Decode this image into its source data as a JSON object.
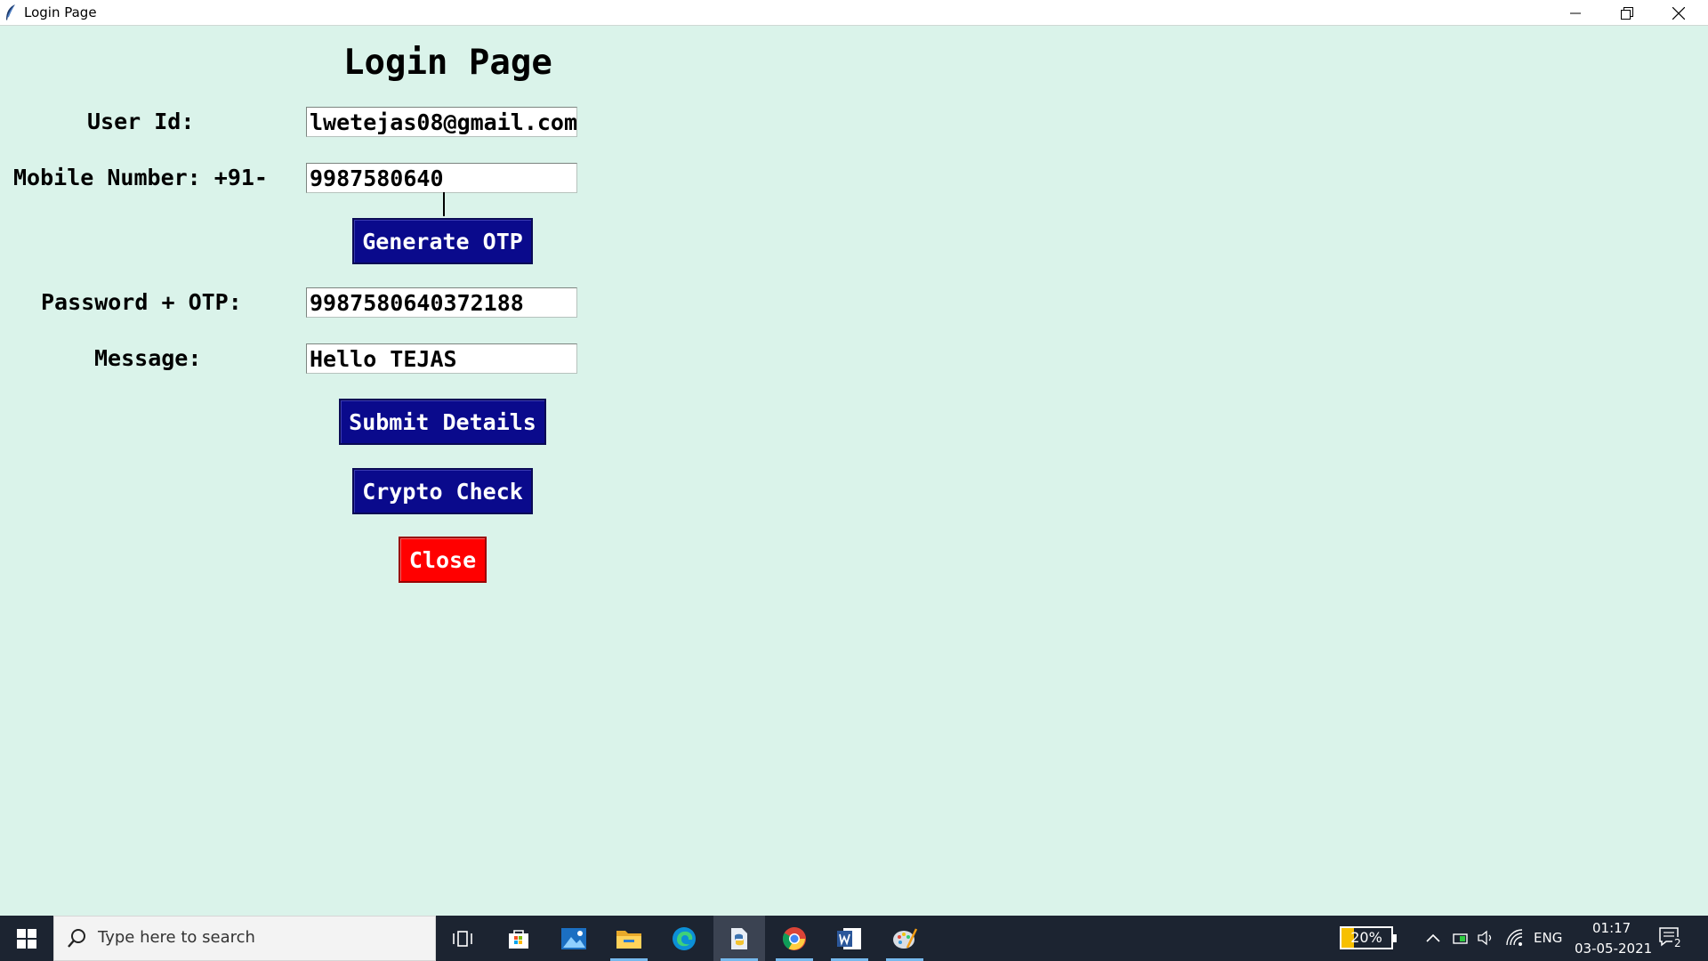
{
  "window": {
    "title": "Login Page"
  },
  "form": {
    "heading": "Login Page",
    "user_id_label": "User Id:",
    "user_id_value": "lwetejas08@gmail.com",
    "mobile_label": "Mobile Number: +91-",
    "mobile_value": "9987580640",
    "password_label": "Password + OTP:",
    "password_value": "9987580640372188",
    "message_label": "Message:",
    "message_value": "Hello TEJAS",
    "generate_otp_label": "Generate OTP",
    "submit_label": "Submit Details",
    "crypto_label": "Crypto Check",
    "close_label": "Close"
  },
  "colors": {
    "background": "#daf3ea",
    "button_primary": "#0a0a8c",
    "button_close": "#ff0000",
    "taskbar": "#1c2431"
  },
  "taskbar": {
    "search_placeholder": "Type here to search",
    "pinned": [
      "task-view-icon",
      "store-icon",
      "photos-icon",
      "file-explorer-icon",
      "edge-icon",
      "python-idle-icon",
      "chrome-icon",
      "word-icon",
      "paint-icon"
    ],
    "battery_percent": "20%",
    "language": "ENG",
    "time": "01:17",
    "date": "03-05-2021",
    "notification_count": "2"
  }
}
